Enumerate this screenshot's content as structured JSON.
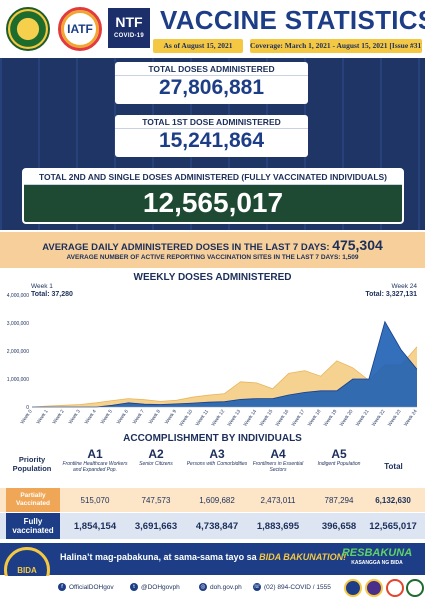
{
  "header": {
    "title": "VACCINE STATISTICS",
    "as_of": "As of August 15, 2021",
    "coverage": "Coverage: March 1, 2021 - August 15, 2021 [Issue #31]",
    "logo_iatf": "IATF",
    "logo_ntf": "NTF",
    "logo_ntf_sub": "COVID-19"
  },
  "doses": {
    "total_label": "TOTAL DOSES ADMINISTERED",
    "total_value": "27,806,881",
    "first_label": "TOTAL 1ST DOSE ADMINISTERED",
    "first_value": "15,241,864",
    "full_label": "TOTAL 2ND AND SINGLE DOSES ADMINISTERED (FULLY VACCINATED INDIVIDUALS)",
    "full_value": "12,565,017"
  },
  "averages": {
    "daily_label": "AVERAGE DAILY ADMINISTERED DOSES IN THE LAST 7 DAYS:",
    "daily_value": "475,304",
    "sites_label": "AVERAGE NUMBER OF ACTIVE REPORTING VACCINATION SITES IN THE LAST 7 DAYS: 1,509"
  },
  "chart_data": {
    "type": "area",
    "title": "WEEKLY DOSES ADMINISTERED",
    "categories": [
      "Week 0",
      "Week 1",
      "Week 2",
      "Week 3",
      "Week 4",
      "Week 5",
      "Week 6",
      "Week 7",
      "Week 8",
      "Week 9",
      "Week 10",
      "Week 11",
      "Week 12",
      "Week 13",
      "Week 14",
      "Week 15",
      "Week 16",
      "Week 17",
      "Week 18",
      "Week 19",
      "Week 20",
      "Week 21",
      "Week 22",
      "Week 23",
      "Week 24"
    ],
    "series": [
      {
        "values": [
          0,
          37280,
          60000,
          90000,
          150000,
          230000,
          300000,
          260000,
          200000,
          240000,
          350000,
          420000,
          480000,
          900000,
          860000,
          650000,
          1200000,
          1300000,
          1100000,
          1650000,
          1400000,
          950000,
          1500000,
          1500000,
          2150000
        ],
        "color": "#f5d08a"
      },
      {
        "values": [
          0,
          0,
          0,
          0,
          0,
          60000,
          150000,
          100000,
          90000,
          110000,
          140000,
          170000,
          190000,
          270000,
          300000,
          300000,
          430000,
          520000,
          580000,
          580000,
          1000000,
          1000000,
          3050000,
          2050000,
          1350000
        ],
        "color": "#1d5fb3"
      }
    ],
    "ylim": [
      0,
      4000000
    ],
    "yticks": [
      "0",
      "1,000,000",
      "2,000,000",
      "3,000,000",
      "4,000,000"
    ],
    "grid": false,
    "annotations": {
      "week1_label": "Week 1",
      "week1_total": "Total: 37,280",
      "week24_label": "Week 24",
      "week24_total": "Total: 3,327,131"
    }
  },
  "accomplishment": {
    "title": "ACCOMPLISHMENT BY INDIVIDUALS",
    "priority_label": "Priority Population",
    "total_header": "Total",
    "groups": [
      {
        "code": "A1",
        "desc": "Frontline Healthcare Workers and Expanded Pop."
      },
      {
        "code": "A2",
        "desc": "Senior Citizens"
      },
      {
        "code": "A3",
        "desc": "Persons with Comorbidities"
      },
      {
        "code": "A4",
        "desc": "Frontliners in Essential Sectors"
      },
      {
        "code": "A5",
        "desc": "Indigent Population"
      }
    ],
    "partial": {
      "label": "Partially Vaccinated",
      "values": [
        "515,070",
        "747,573",
        "1,609,682",
        "2,473,011",
        "787,294"
      ],
      "total": "6,132,630"
    },
    "full": {
      "label": "Fully vaccinated",
      "values": [
        "1,854,154",
        "3,691,663",
        "4,738,847",
        "1,883,695",
        "396,658"
      ],
      "total": "12,565,017"
    }
  },
  "banner": {
    "text": "Halina’t mag-pabakuna, at sama-sama tayo sa ",
    "highlight": "BIDA BAKUNATION!",
    "resbakuna": "RESBAKUNA",
    "resbakuna_sub": "KASANGGA NG BIDA",
    "badge": "BIDA"
  },
  "footer": {
    "facebook": "OfficialDOHgov",
    "twitter": "@DOHgovph",
    "website": "doh.gov.ph",
    "phone": "(02) 894-COVID / 1555"
  },
  "colors": {
    "navy": "#1d3e86",
    "dark_green": "#1e4a33",
    "gold": "#f5c844",
    "peach": "#f7cf9a",
    "orange": "#f0a657"
  }
}
